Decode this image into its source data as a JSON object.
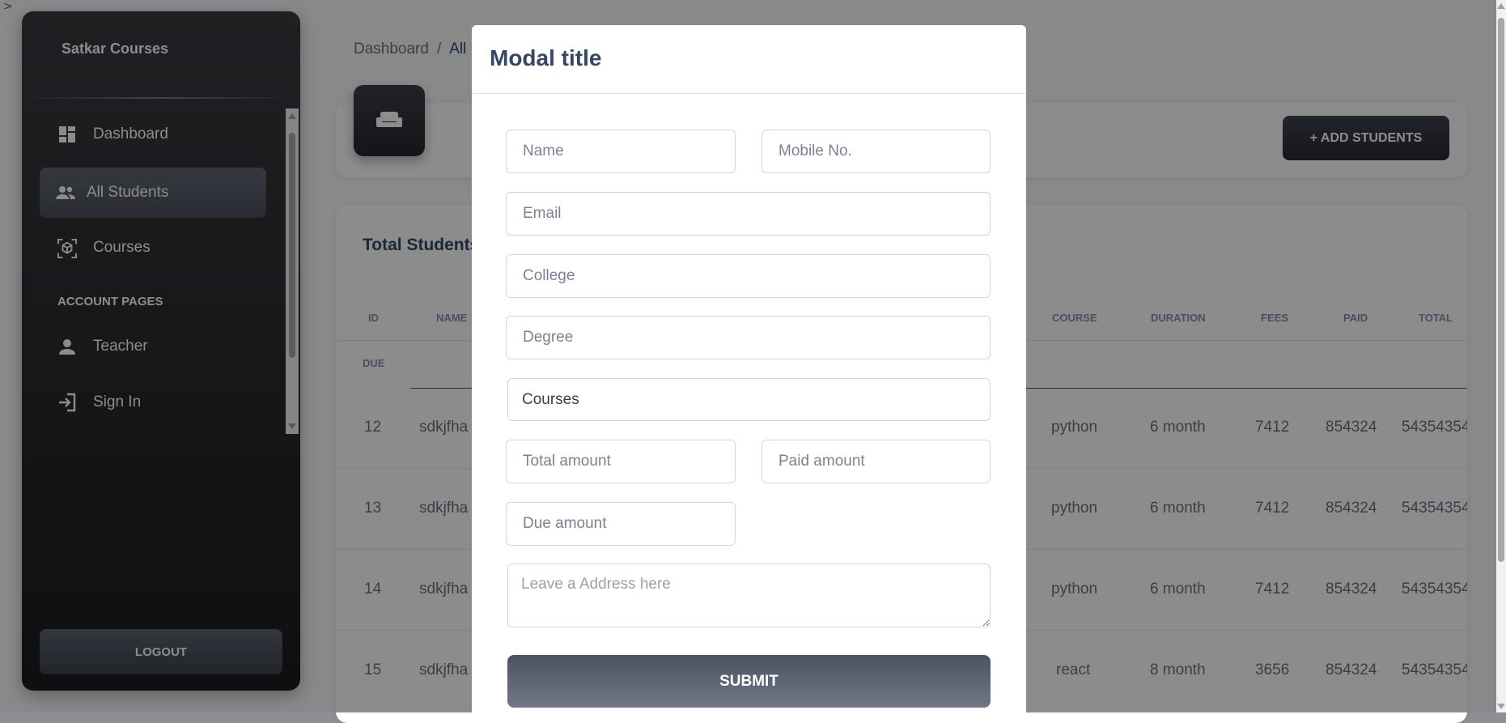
{
  "corner_glyph": ">",
  "sidebar": {
    "brand": "Satkar Courses",
    "items": [
      {
        "label": "Dashboard",
        "icon": "dashboard-icon"
      },
      {
        "label": "All Students",
        "icon": "people-icon"
      },
      {
        "label": "Courses",
        "icon": "cube-icon"
      }
    ],
    "section_title": "ACCOUNT PAGES",
    "account_items": [
      {
        "label": "Teacher",
        "icon": "person-icon"
      },
      {
        "label": "Sign In",
        "icon": "login-icon"
      }
    ],
    "logout_label": "LOGOUT"
  },
  "breadcrumb": {
    "root": "Dashboard",
    "sep": "/",
    "current": "All"
  },
  "header": {
    "icon": "couch-icon",
    "add_button": "+ ADD STUDENTS"
  },
  "table": {
    "title": "Total Students",
    "columns": [
      "ID",
      "NAME",
      "COURSE",
      "DURATION",
      "FEES",
      "PAID",
      "TOTAL",
      "DUE"
    ],
    "rows": [
      {
        "id": "12",
        "name": "sdkjfha",
        "course": "python",
        "duration": "6 month",
        "fees": "7412",
        "paid": "854324",
        "total": "54354354"
      },
      {
        "id": "13",
        "name": "sdkjfha",
        "course": "python",
        "duration": "6 month",
        "fees": "7412",
        "paid": "854324",
        "total": "54354354"
      },
      {
        "id": "14",
        "name": "sdkjfha",
        "course": "python",
        "duration": "6 month",
        "fees": "7412",
        "paid": "854324",
        "total": "54354354"
      },
      {
        "id": "15",
        "name": "sdkjfha",
        "course": "react",
        "duration": "8 month",
        "fees": "3656",
        "paid": "854324",
        "total": "54354354"
      }
    ]
  },
  "modal": {
    "title": "Modal title",
    "fields": {
      "name": "Name",
      "mobile": "Mobile No.",
      "email": "Email",
      "college": "College",
      "degree": "Degree",
      "courses": "Courses",
      "total_amount": "Total amount",
      "paid_amount": "Paid amount",
      "due_amount": "Due amount",
      "address": "Leave a Address here"
    },
    "submit": "SUBMIT"
  },
  "colors": {
    "sidebar_dark": "#1b1c1f",
    "accent_gray": "#4a505b",
    "title_blue": "#344767"
  }
}
